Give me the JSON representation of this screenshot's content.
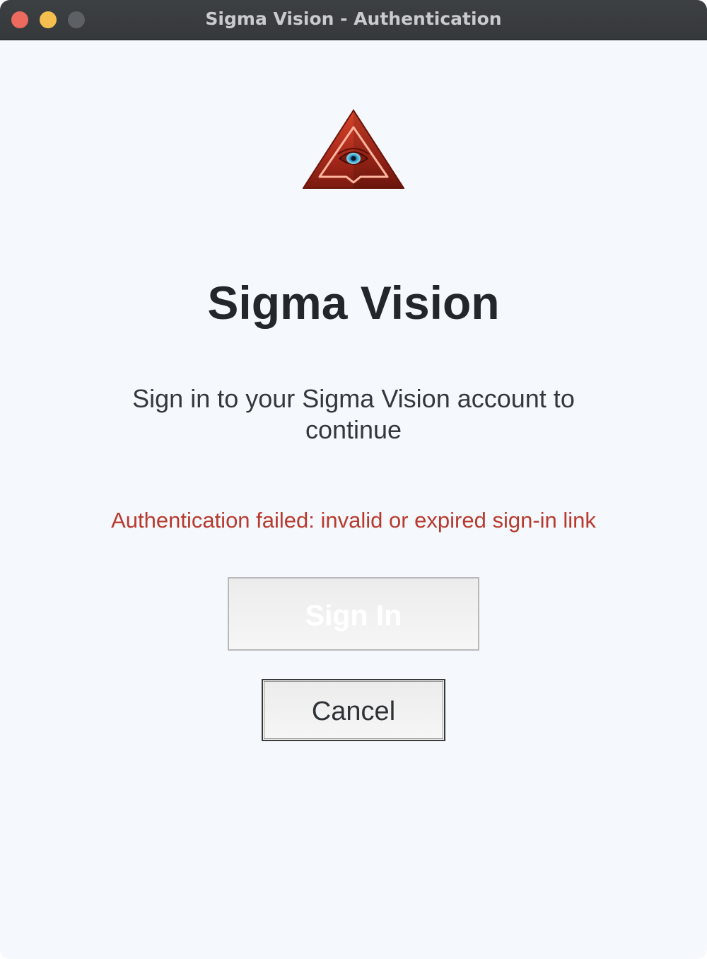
{
  "window": {
    "title": "Sigma Vision - Authentication"
  },
  "logo": {
    "icon": "pyramid-eye-icon",
    "colors": {
      "primary": "#c23a22",
      "dark": "#7a1a10",
      "glow": "#ff8a6a",
      "eye": "#4fc3e6"
    }
  },
  "main": {
    "app_name": "Sigma Vision",
    "subtitle": "Sign in to your Sigma Vision account to continue",
    "error_message": "Authentication failed: invalid or expired sign-in link",
    "sign_in_label": "Sign In",
    "sign_in_state": "disabled",
    "cancel_label": "Cancel"
  },
  "colors": {
    "background": "#f5f8fc",
    "titlebar": "#3a3d40",
    "error": "#b83a2e",
    "text": "#23272b"
  }
}
